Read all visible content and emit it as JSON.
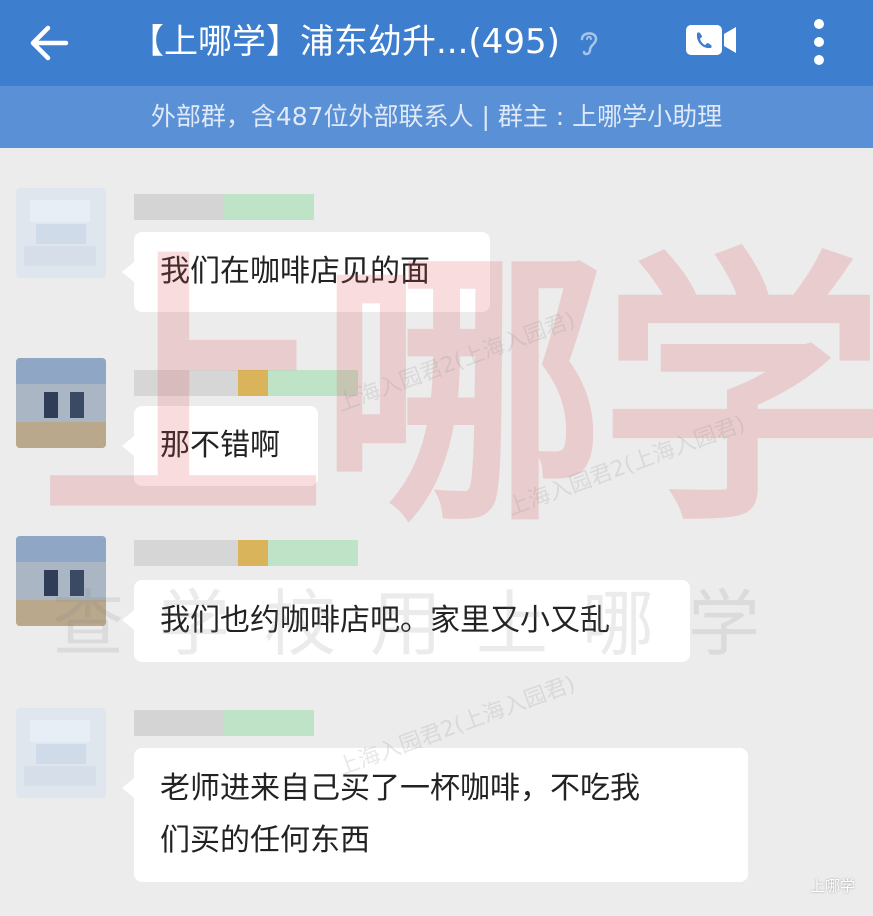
{
  "header": {
    "title": "【上哪学】浦东幼升...(495)",
    "subtitle": "外部群，含487位外部联系人 | 群主 : 上哪学小助理",
    "bar_color": "#3d7ecf",
    "icons": [
      "back-arrow",
      "ear",
      "video-call",
      "more-vertical"
    ]
  },
  "messages": [
    {
      "text": "我们在咖啡店见的面"
    },
    {
      "text": "那不错啊"
    },
    {
      "text": "我们也约咖啡店吧。家里又小又乱"
    },
    {
      "line1": "老师进来自己买了一杯咖啡，不吃我",
      "line2": "们买的任何东西"
    }
  ],
  "watermarks": {
    "big": "上哪学",
    "row": "查学校用上哪学",
    "diagonal": "上海入园君2(上海入园君)",
    "corner": "上哪学"
  }
}
